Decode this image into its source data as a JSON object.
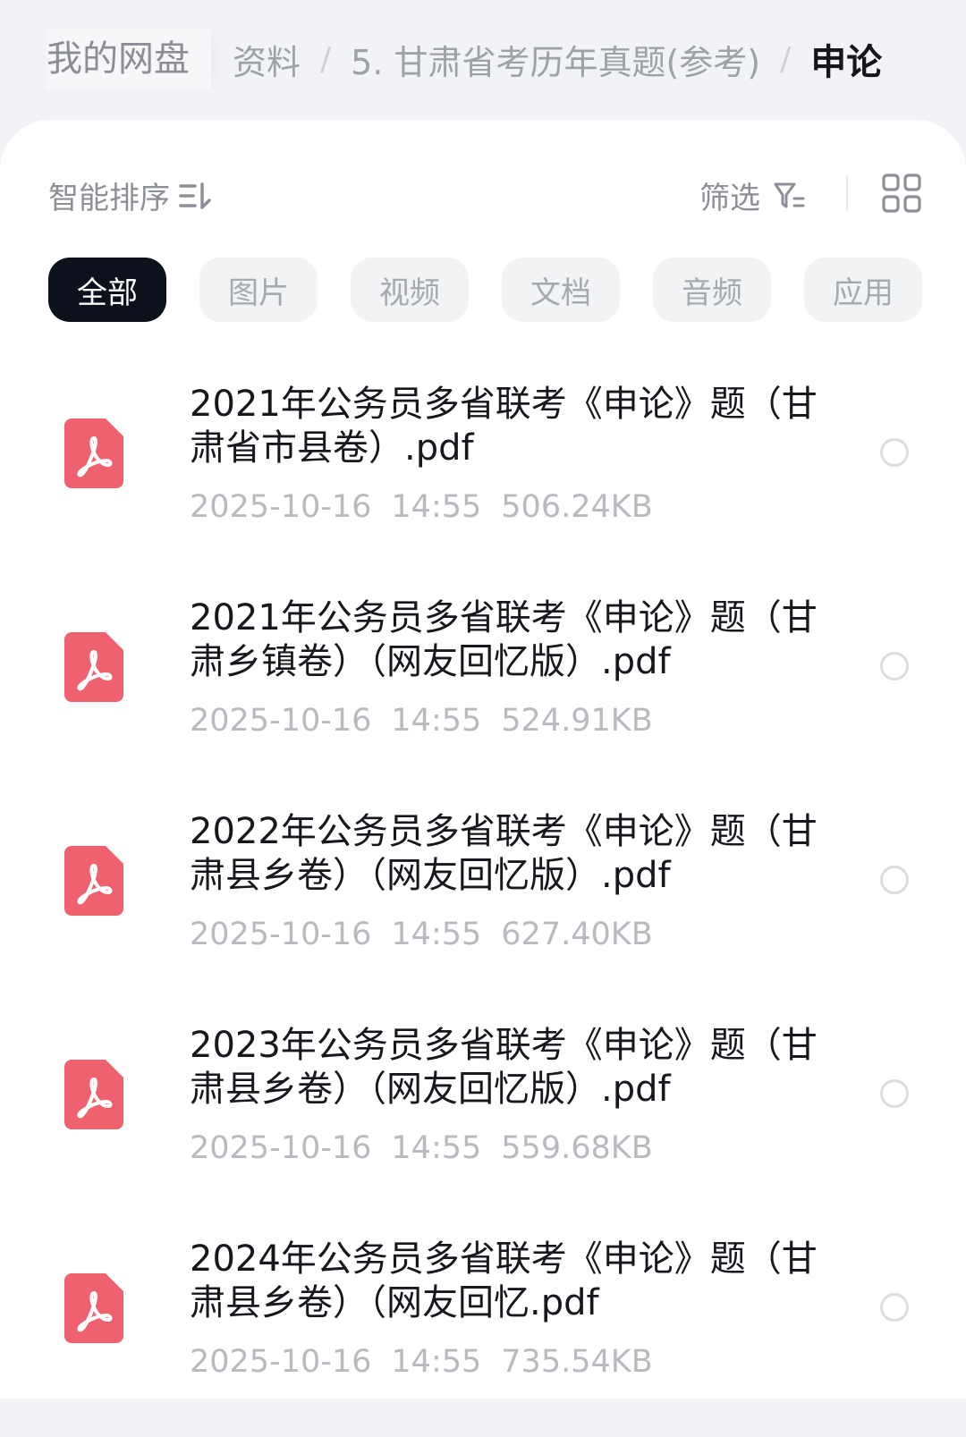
{
  "breadcrumb": {
    "root": "我的网盘",
    "truncated": "资料",
    "folder": "5. 甘肃省考历年真题(参考)",
    "separator": "/",
    "current": "申论"
  },
  "toolbar": {
    "sort_label": "智能排序",
    "sort_icon": "sort-lines-icon",
    "filter_label": "筛选",
    "filter_icon": "filter-funnel-icon",
    "view_icon": "grid-view-icon"
  },
  "tabs": [
    {
      "label": "全部",
      "active": true
    },
    {
      "label": "图片",
      "active": false
    },
    {
      "label": "视频",
      "active": false
    },
    {
      "label": "文档",
      "active": false
    },
    {
      "label": "音频",
      "active": false
    },
    {
      "label": "应用",
      "active": false
    }
  ],
  "files": [
    {
      "name": "2021年公务员多省联考《申论》题（甘肃省市县卷）.pdf",
      "date": "2025-10-16",
      "time": "14:55",
      "size": "506.24KB",
      "icon": "pdf-icon"
    },
    {
      "name": "2021年公务员多省联考《申论》题（甘肃乡镇卷）（网友回忆版）.pdf",
      "date": "2025-10-16",
      "time": "14:55",
      "size": "524.91KB",
      "icon": "pdf-icon"
    },
    {
      "name": "2022年公务员多省联考《申论》题（甘肃县乡卷）（网友回忆版）.pdf",
      "date": "2025-10-16",
      "time": "14:55",
      "size": "627.40KB",
      "icon": "pdf-icon"
    },
    {
      "name": "2023年公务员多省联考《申论》题（甘肃县乡卷）（网友回忆版）.pdf",
      "date": "2025-10-16",
      "time": "14:55",
      "size": "559.68KB",
      "icon": "pdf-icon"
    },
    {
      "name": "2024年公务员多省联考《申论》题（甘肃县乡卷）（网友回忆.pdf",
      "date": "2025-10-16",
      "time": "14:55",
      "size": "735.54KB",
      "icon": "pdf-icon"
    }
  ],
  "colors": {
    "pdf_icon": "#f0616f",
    "tab_active_bg": "#0d111c",
    "tab_bg": "#f2f3f5"
  }
}
